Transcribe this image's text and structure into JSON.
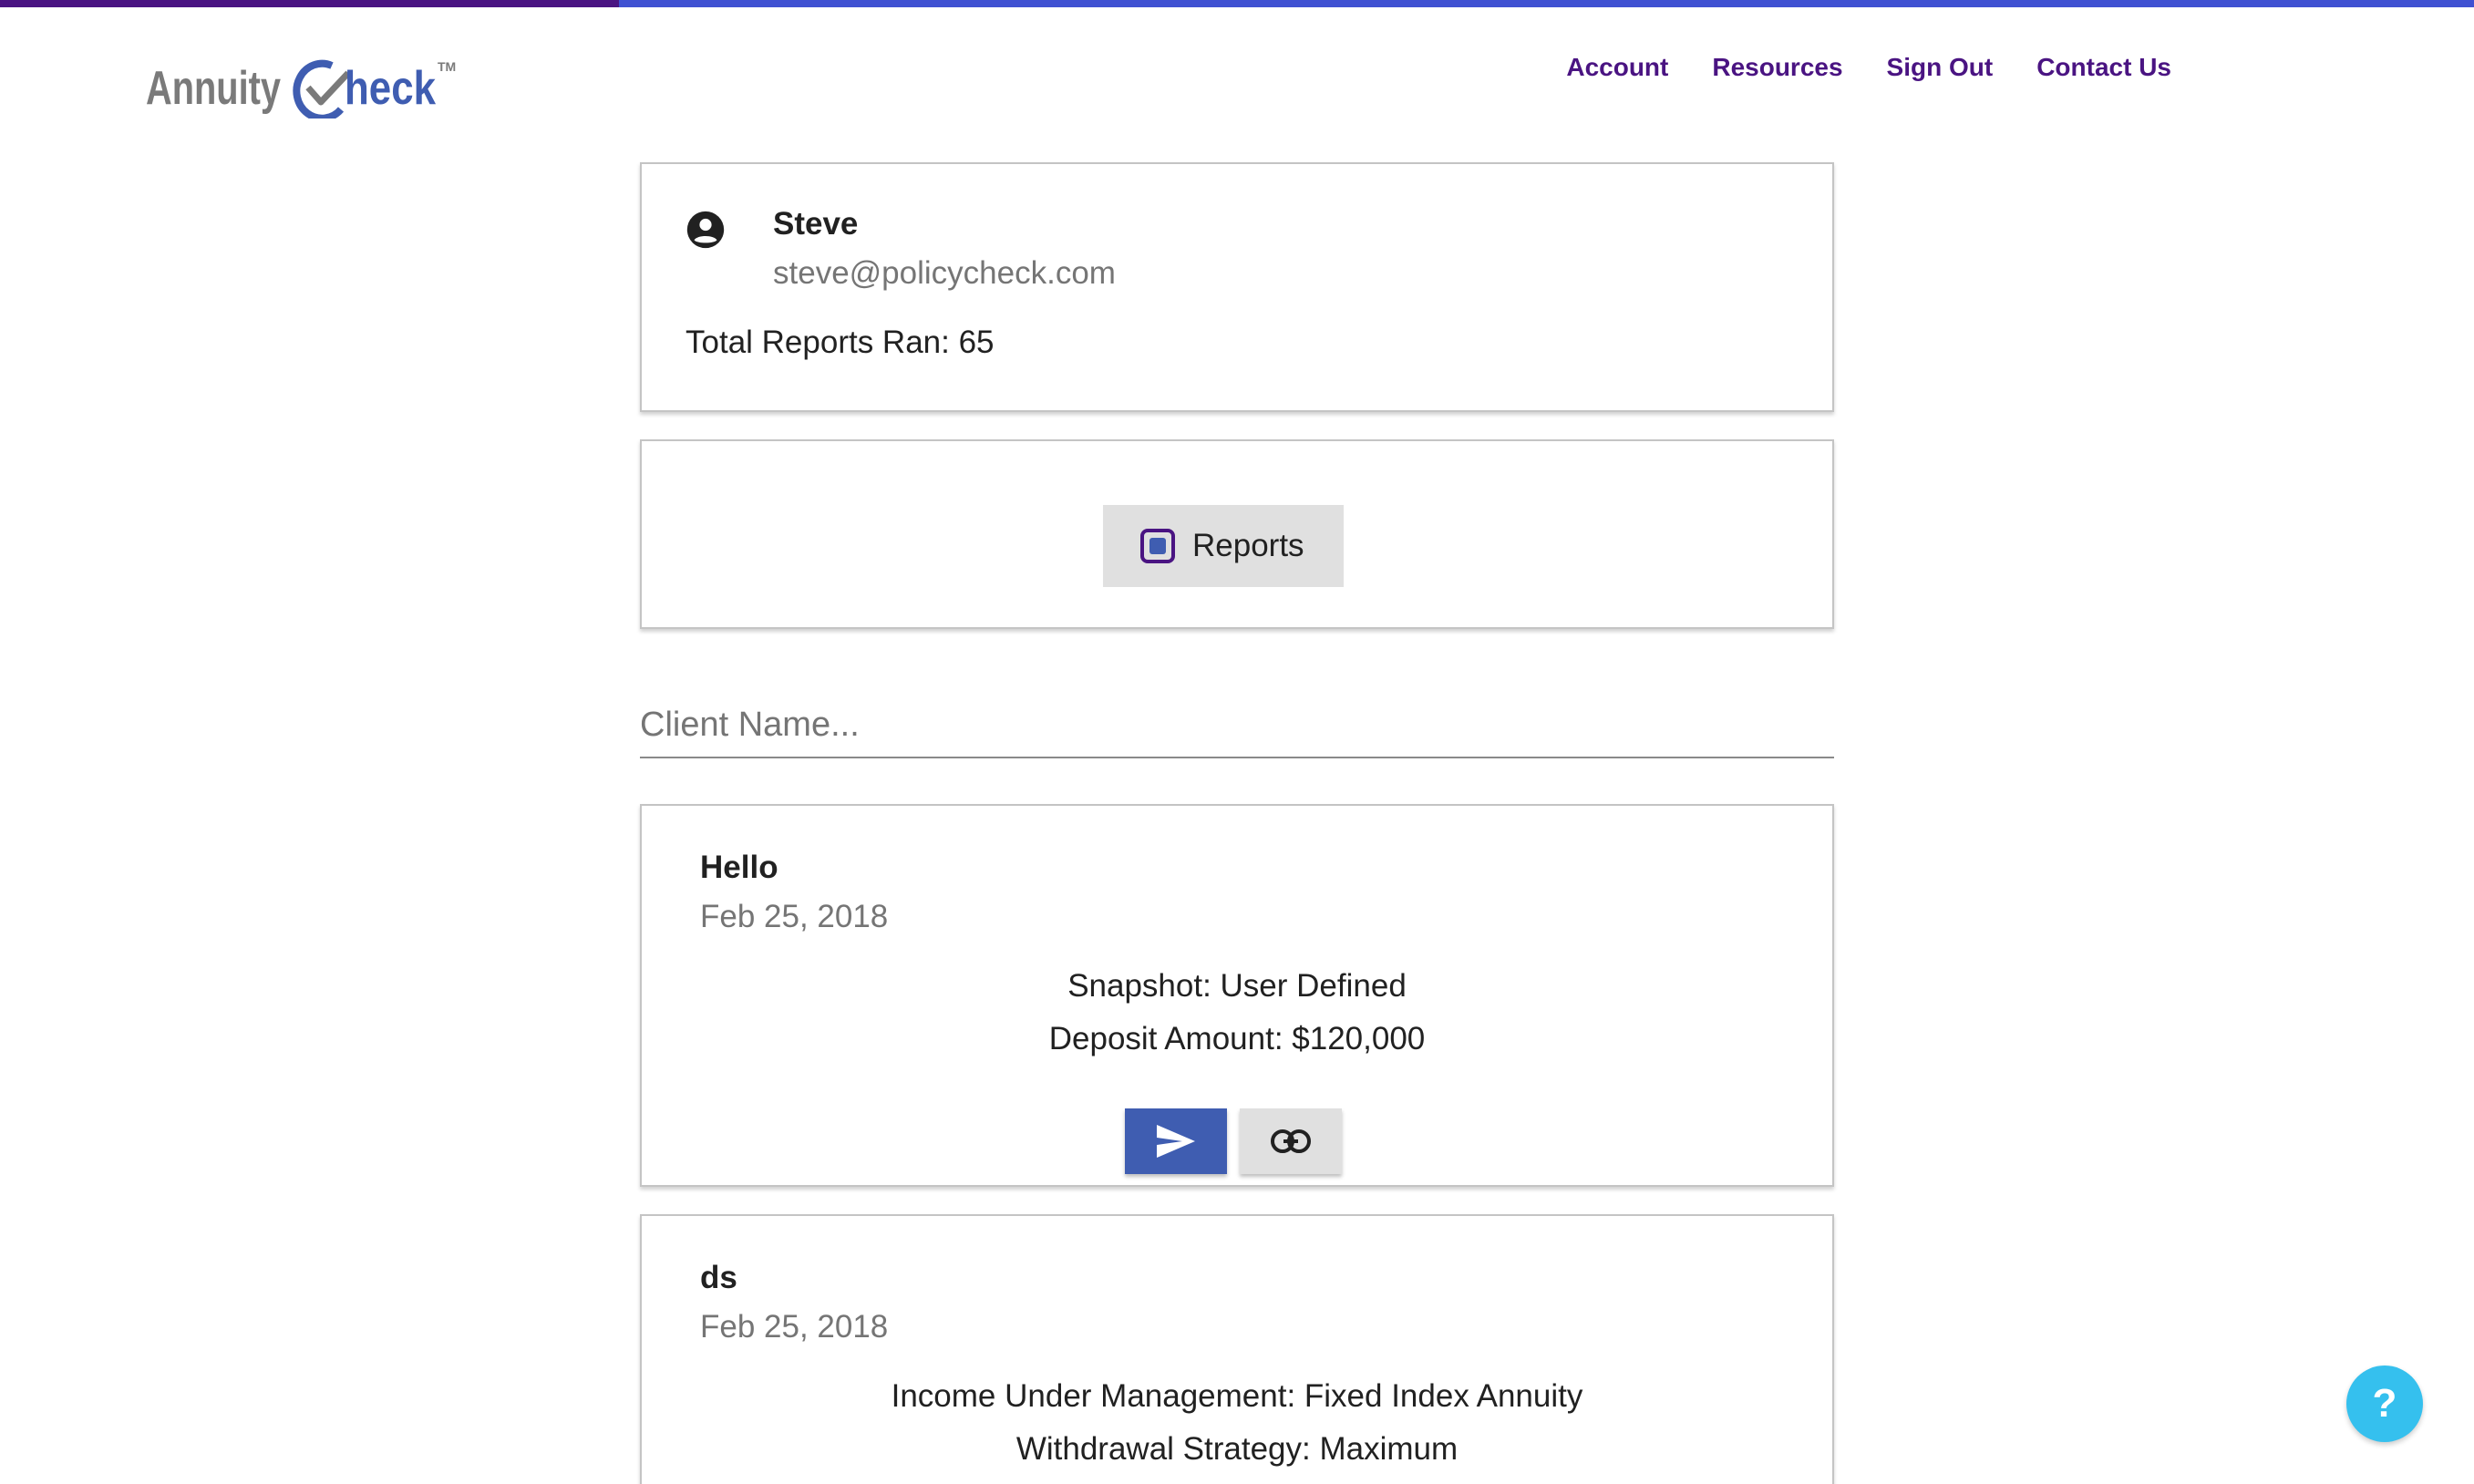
{
  "progress": {
    "fraction": 0.25,
    "fill_color": "#4a1482",
    "track_color": "#3f51d2"
  },
  "header": {
    "logo": {
      "text_gray": "Annuity",
      "text_blue": "heck",
      "trademark": "TM"
    },
    "nav": [
      {
        "label": "Account"
      },
      {
        "label": "Resources"
      },
      {
        "label": "Sign Out"
      },
      {
        "label": "Contact Us"
      }
    ]
  },
  "profile": {
    "icon": "account-circle-icon",
    "name": "Steve",
    "email": "steve@policycheck.com",
    "total_reports": "Total Reports Ran: 65"
  },
  "reports_toggle": {
    "label": "Reports",
    "icon": "checkbox-square-icon"
  },
  "search": {
    "placeholder": "Client Name...",
    "value": ""
  },
  "results": [
    {
      "title": "Hello",
      "date": "Feb 25, 2018",
      "lines": [
        "Snapshot: User Defined",
        "Deposit Amount: $120,000"
      ],
      "actions": [
        {
          "icon": "send-icon"
        },
        {
          "icon": "link-icon"
        }
      ]
    },
    {
      "title": "ds",
      "date": "Feb 25, 2018",
      "lines": [
        "Income Under Management: Fixed Index Annuity",
        "Withdrawal Strategy: Maximum"
      ]
    }
  ],
  "help": {
    "label": "?"
  },
  "colors": {
    "brand_purple": "#4a1482",
    "brand_blue": "#3f5db1",
    "help_blue": "#35c0ee"
  }
}
